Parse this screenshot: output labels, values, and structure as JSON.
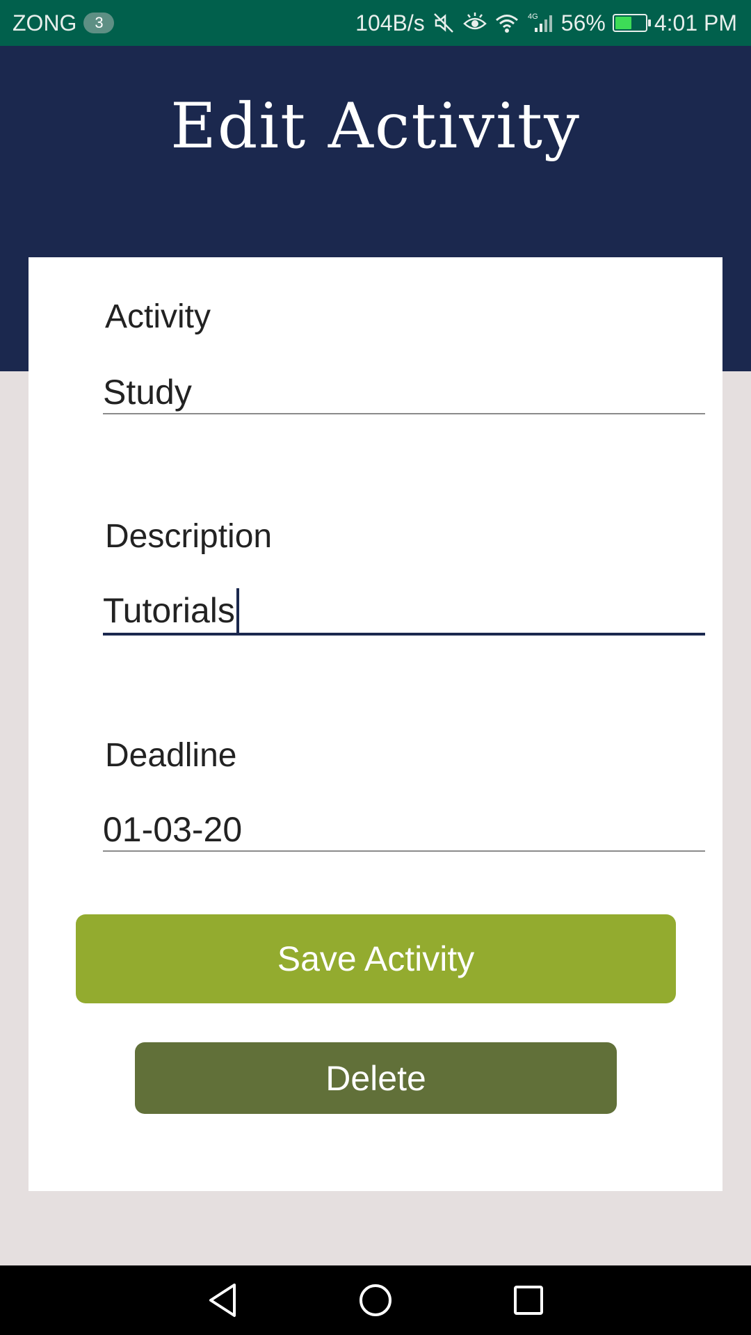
{
  "status_bar": {
    "carrier": "ZONG",
    "sim_badge": "3",
    "net_speed": "104B/s",
    "network_type": "4G",
    "battery_percent": "56%",
    "battery_level": 0.56,
    "time": "4:01 PM",
    "icons": [
      "mute-icon",
      "eye-comfort-icon",
      "wifi-icon",
      "signal-icon",
      "battery-charging-icon"
    ]
  },
  "header": {
    "title": "Edit Activity"
  },
  "form": {
    "activity": {
      "label": "Activity",
      "value": "Study"
    },
    "description": {
      "label": "Description",
      "value": "Tutorials"
    },
    "deadline": {
      "label": "Deadline",
      "value": "01-03-20"
    }
  },
  "buttons": {
    "save_label": "Save Activity",
    "delete_label": "Delete"
  },
  "nav": {
    "icons": [
      "back-icon",
      "home-icon",
      "recents-icon"
    ]
  },
  "colors": {
    "status_bar": "#01604c",
    "header": "#1b284e",
    "save_button": "#93ab2f",
    "delete_button": "#617039",
    "page_background": "#e5dfdf"
  }
}
